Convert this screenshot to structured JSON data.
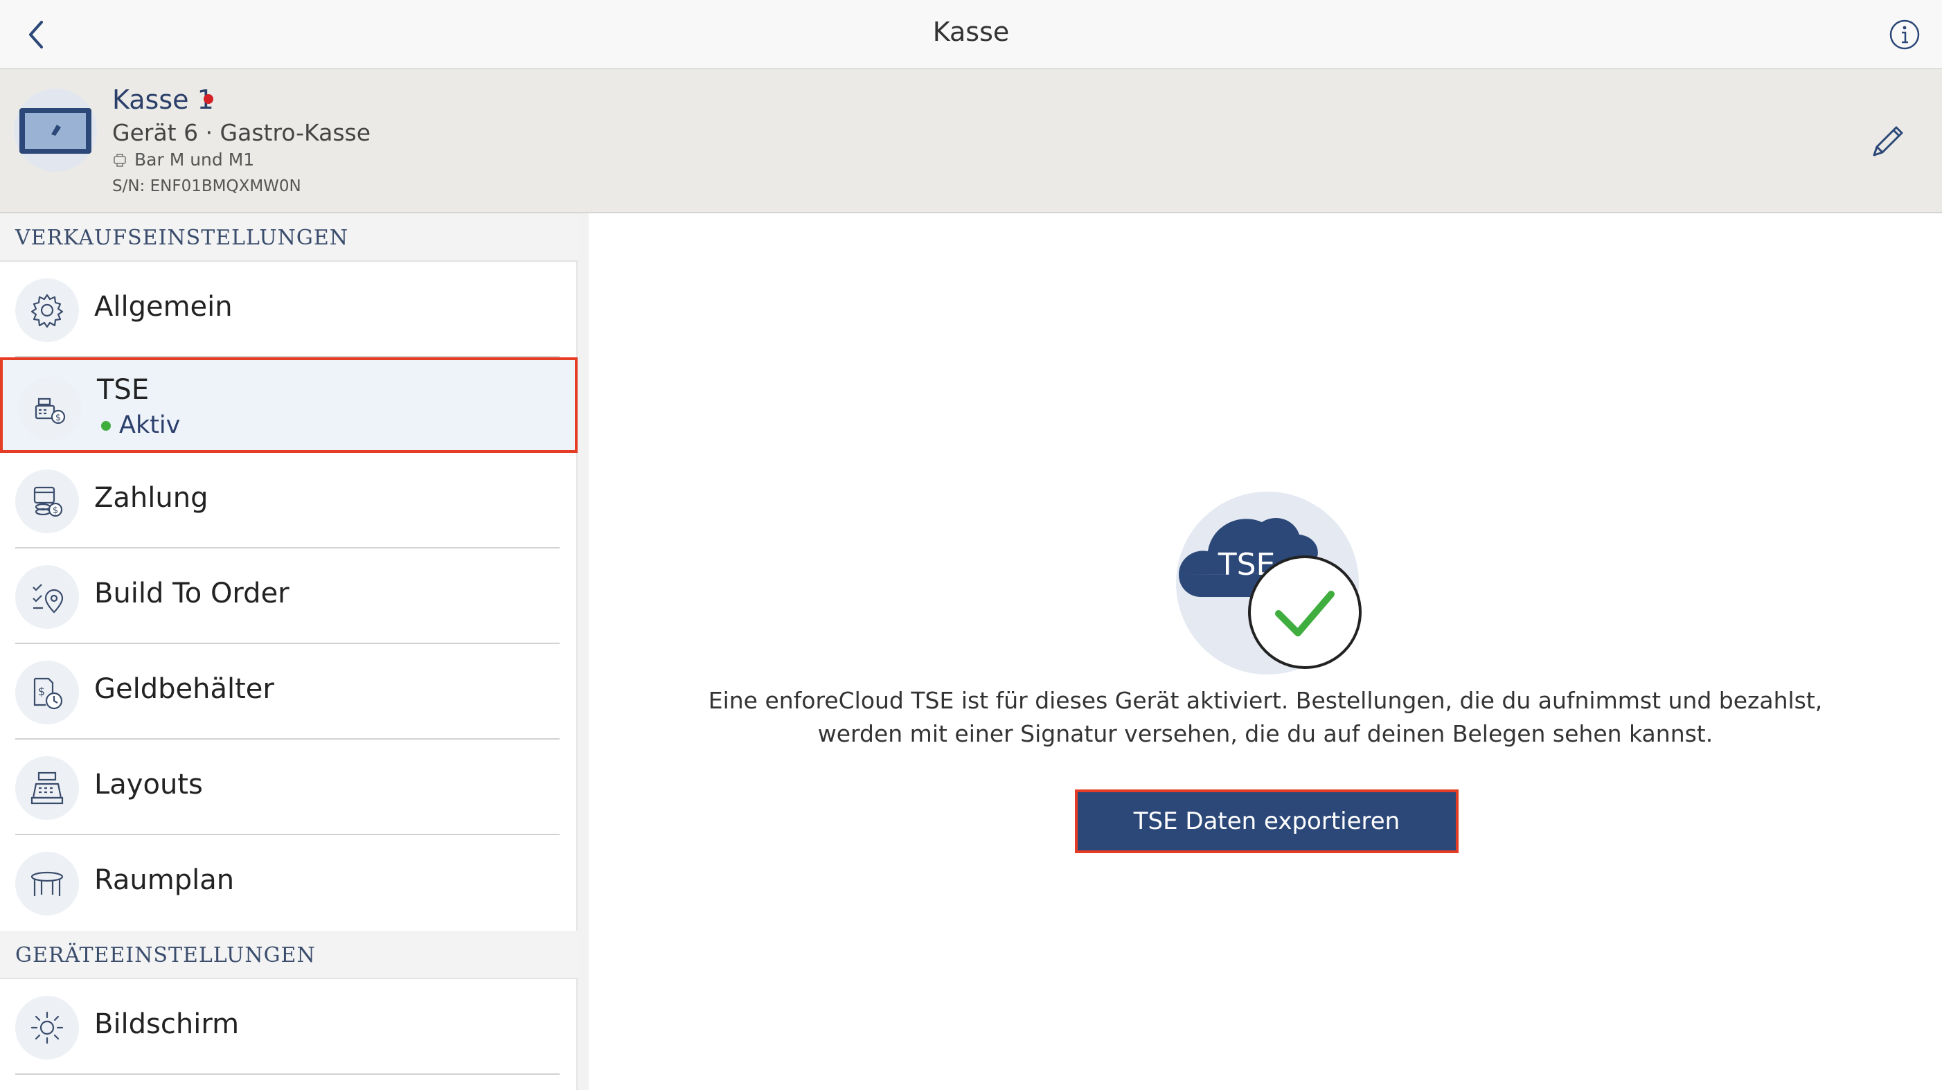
{
  "header": {
    "title": "Kasse"
  },
  "device": {
    "name": "Kasse 1",
    "subtitle": "Gerät 6 · Gastro-Kasse",
    "location": "Bar M und M1",
    "serial": "S/N: ENF01BMQXMW0N",
    "status_color": "#d42027"
  },
  "sidebar": {
    "sales_section": "VERKAUFSEINSTELLUNGEN",
    "device_section": "GERÄTEEINSTELLUNGEN",
    "items": [
      {
        "label": "Allgemein",
        "icon": "gear-icon"
      },
      {
        "label": "TSE",
        "status": "Aktiv",
        "icon": "cash-register-tax-icon",
        "selected": true
      },
      {
        "label": "Zahlung",
        "icon": "coins-payment-icon"
      },
      {
        "label": "Build To Order",
        "icon": "checklist-pin-icon"
      },
      {
        "label": "Geldbehälter",
        "icon": "money-clock-icon"
      },
      {
        "label": "Layouts",
        "icon": "cash-register-icon"
      },
      {
        "label": "Raumplan",
        "icon": "table-icon"
      },
      {
        "label": "Bildschirm",
        "icon": "sun-brightness-icon"
      }
    ]
  },
  "content": {
    "illustration_label": "TSE",
    "description": "Eine enforeCloud TSE ist für dieses Gerät aktiviert. Bestellungen, die du aufnimmst und bezahlst, werden mit einer Signatur versehen, die du auf deinen Belegen sehen kannst.",
    "export_button": "TSE Daten exportieren"
  },
  "colors": {
    "brand_navy": "#2c4878",
    "highlight_red": "#e53d25",
    "active_green": "#3fae3e"
  }
}
